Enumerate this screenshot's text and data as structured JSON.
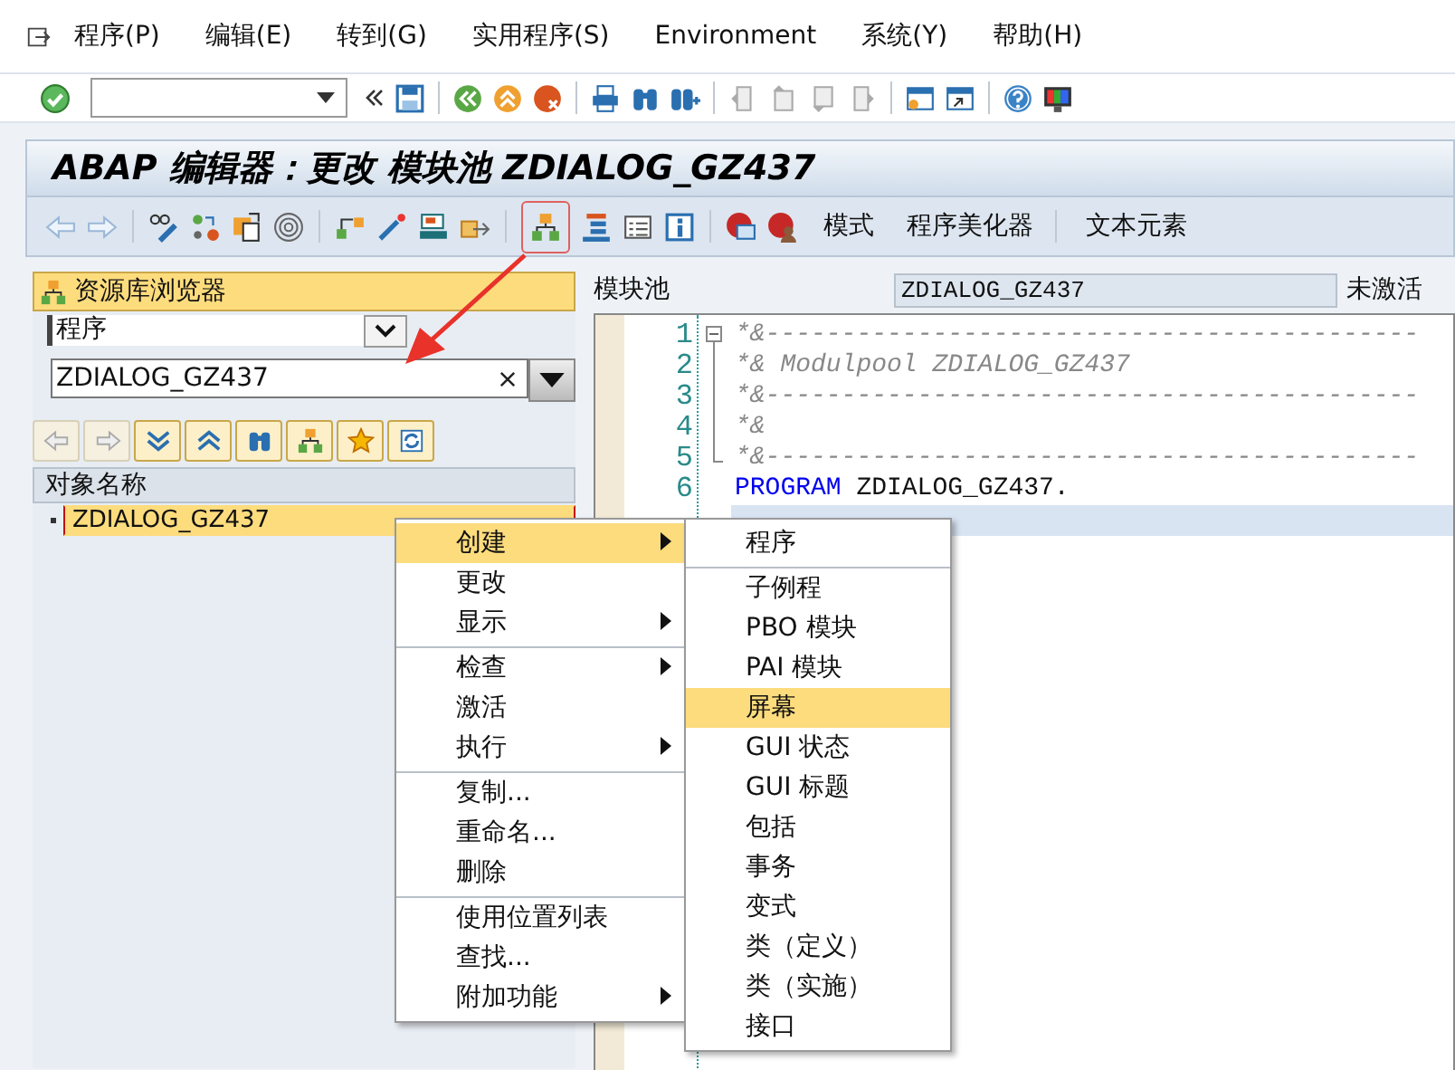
{
  "menu_bar": [
    "程序(P)",
    "编辑(E)",
    "转到(G)",
    "实用程序(S)",
    "Environment",
    "系统(Y)",
    "帮助(H)"
  ],
  "title": "ABAP 编辑器：更改 模块池 ZDIALOG_GZ437",
  "app_toolbar": {
    "buttons": [
      "模式",
      "程序美化器",
      "文本元素"
    ]
  },
  "repository_browser": {
    "title": "资源库浏览器",
    "object_type": "程序",
    "object_name": "ZDIALOG_GZ437",
    "tree_header": "对象名称",
    "tree": [
      {
        "label": "ZDIALOG_GZ437",
        "selected": true
      }
    ]
  },
  "editor": {
    "label": "模块池",
    "name": "ZDIALOG_GZ437",
    "status": "未激活",
    "lines": [
      {
        "number": "1",
        "kind": "comment",
        "text": "*&-------------------------------------------",
        "current": false
      },
      {
        "number": "2",
        "kind": "comment",
        "text": "*& Modulpool ZDIALOG_GZ437",
        "current": false
      },
      {
        "number": "3",
        "kind": "comment",
        "text": "*&-------------------------------------------",
        "current": false
      },
      {
        "number": "4",
        "kind": "comment",
        "text": "*&",
        "current": false
      },
      {
        "number": "5",
        "kind": "comment",
        "text": "*&-------------------------------------------",
        "current": false
      },
      {
        "number": "6",
        "kind": "statement",
        "keyword": "PROGRAM",
        "text": "ZDIALOG_GZ437.",
        "current": false
      },
      {
        "kind": "blank",
        "current": true
      }
    ]
  },
  "context_menu": {
    "items": [
      {
        "label": "创建",
        "selected": true,
        "has_submenu": true,
        "separator_before": false
      },
      {
        "label": "更改",
        "selected": false,
        "has_submenu": false,
        "separator_before": false
      },
      {
        "label": "显示",
        "selected": false,
        "has_submenu": true,
        "separator_before": false
      },
      {
        "label": "检查",
        "selected": false,
        "has_submenu": true,
        "separator_before": true
      },
      {
        "label": "激活",
        "selected": false,
        "has_submenu": false,
        "separator_before": false
      },
      {
        "label": "执行",
        "selected": false,
        "has_submenu": true,
        "separator_before": false
      },
      {
        "label": "复制...",
        "selected": false,
        "has_submenu": false,
        "separator_before": true
      },
      {
        "label": "重命名...",
        "selected": false,
        "has_submenu": false,
        "separator_before": false
      },
      {
        "label": "删除",
        "selected": false,
        "has_submenu": false,
        "separator_before": false
      },
      {
        "label": "使用位置列表",
        "selected": false,
        "has_submenu": false,
        "separator_before": true
      },
      {
        "label": "查找...",
        "selected": false,
        "has_submenu": false,
        "separator_before": false
      },
      {
        "label": "附加功能",
        "selected": false,
        "has_submenu": true,
        "separator_before": false
      }
    ]
  },
  "submenu": {
    "items": [
      {
        "label": "程序",
        "selected": false,
        "separator_before": false
      },
      {
        "label": "子例程",
        "selected": false,
        "separator_before": true
      },
      {
        "label": "PBO 模块",
        "selected": false,
        "separator_before": false
      },
      {
        "label": "PAI 模块",
        "selected": false,
        "separator_before": false
      },
      {
        "label": "屏幕",
        "selected": true,
        "separator_before": false
      },
      {
        "label": "GUI 状态",
        "selected": false,
        "separator_before": false
      },
      {
        "label": "GUI 标题",
        "selected": false,
        "separator_before": false
      },
      {
        "label": "包括",
        "selected": false,
        "separator_before": false
      },
      {
        "label": "事务",
        "selected": false,
        "separator_before": false
      },
      {
        "label": "变式",
        "selected": false,
        "separator_before": false
      },
      {
        "label": "类（定义）",
        "selected": false,
        "separator_before": false
      },
      {
        "label": "类（实施）",
        "selected": false,
        "separator_before": false
      },
      {
        "label": "接口",
        "selected": false,
        "separator_before": false
      }
    ]
  }
}
